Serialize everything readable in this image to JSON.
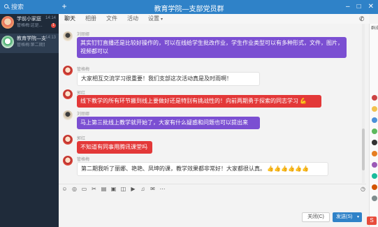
{
  "window": {
    "title": "教育学院—支部党员群"
  },
  "search": {
    "label": "搜索"
  },
  "sessions": [
    {
      "name": "学前小家庭",
      "message": "管格梅:这是...",
      "time": "14:14",
      "badge": "1"
    },
    {
      "name": "教育学院—支部…",
      "message": "管格梅:第二期我听了…",
      "time": "14:13",
      "badge": ""
    }
  ],
  "tabs": [
    {
      "label": "聊天"
    },
    {
      "label": "相册"
    },
    {
      "label": "文件"
    },
    {
      "label": "活动"
    },
    {
      "label": "设置"
    }
  ],
  "messages": [
    {
      "sender": "刘丽娜",
      "text": "其实钉钉直播还是比较好操作的，可以在线给学生批改作业，学生作业类型可以有多种形式，文件，图片，视频都可以",
      "style": "purple"
    },
    {
      "sender": "管格梅",
      "text": "大家相互交流学习很重要！我们支部这次活动真是及时雨啊！",
      "style": "white"
    },
    {
      "sender": "郭红",
      "text": "线下教学的所有环节搬到线上要做好还是特别有挑战性的！向前两期勇于探索的同志学习",
      "style": "red"
    },
    {
      "sender": "刘丽娜",
      "text": "马上第三批线上教学就开始了，大家有什么疑惑和问题也可以提出来",
      "style": "purple"
    },
    {
      "sender": "郭红",
      "text": "不知道有同事用腾讯课堂吗",
      "style": "red"
    },
    {
      "sender": "管格梅",
      "text": "第二期我听了丽娜、艳艳、凤坤的课，教学效果都非常好！大家都很认真。",
      "style": "white"
    }
  ],
  "thumbs": [
    "👍",
    "👍",
    "👍",
    "👍",
    "👍",
    "👍"
  ],
  "buttons": {
    "close": "关闭(C)",
    "send": "发送(S)"
  },
  "members_label": "群成员",
  "colors": {
    "accent": "#2f82c8",
    "purple_bubble": "#7b4fd2",
    "red_bubble": "#e33838"
  }
}
